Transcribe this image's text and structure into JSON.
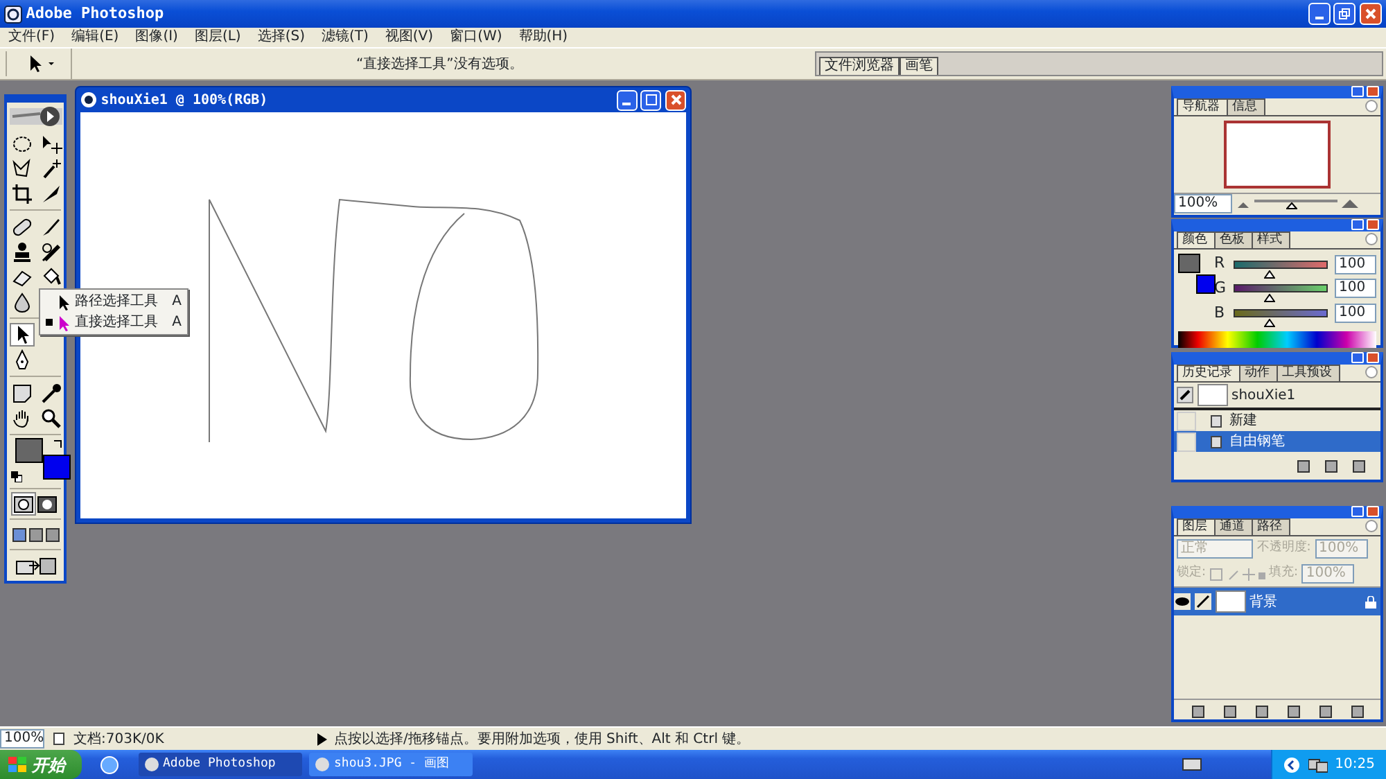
{
  "window": {
    "title": "Adobe Photoshop"
  },
  "menu": [
    "文件(F)",
    "编辑(E)",
    "图像(I)",
    "图层(L)",
    "选择(S)",
    "滤镜(T)",
    "视图(V)",
    "窗口(W)",
    "帮助(H)"
  ],
  "options_bar": {
    "message": "“直接选择工具”没有选项。"
  },
  "palette_well": {
    "tabs": [
      "文件浏览器",
      "画笔"
    ]
  },
  "tool_flyout": [
    {
      "label": "路径选择工具",
      "shortcut": "A",
      "selected": false
    },
    {
      "label": "直接选择工具",
      "shortcut": "A",
      "selected": true
    }
  ],
  "document": {
    "title": "shouXie1 @ 100%(RGB)"
  },
  "navigator": {
    "tabs": [
      {
        "label": "导航器",
        "selected": true
      },
      {
        "label": "信息",
        "selected": false
      }
    ],
    "zoom": "100%",
    "zoom_slider": {
      "level": 0.45
    }
  },
  "color_panel": {
    "tabs": [
      {
        "label": "颜色",
        "selected": true
      },
      {
        "label": "色板",
        "selected": false
      },
      {
        "label": "样式",
        "selected": false
      }
    ],
    "channels": [
      {
        "name": "R",
        "value": "100",
        "level": 0.39
      },
      {
        "name": "G",
        "value": "100",
        "level": 0.39
      },
      {
        "name": "B",
        "value": "100",
        "level": 0.39
      }
    ]
  },
  "history": {
    "tabs": [
      {
        "label": "历史记录",
        "selected": true
      },
      {
        "label": "动作",
        "selected": false
      },
      {
        "label": "工具预设",
        "selected": false
      }
    ],
    "snapshot": "shouXie1",
    "states": [
      {
        "label": "新建",
        "selected": false
      },
      {
        "label": "自由钢笔",
        "selected": true
      }
    ]
  },
  "layers": {
    "tabs": [
      {
        "label": "图层",
        "selected": true
      },
      {
        "label": "通道",
        "selected": false
      },
      {
        "label": "路径",
        "selected": false
      }
    ],
    "blend_mode": "正常",
    "opacity_label": "不透明度:",
    "opacity": "100%",
    "lock_label": "锁定:",
    "fill_label": "填充:",
    "fill": "100%",
    "items": [
      {
        "name": "背景",
        "selected": true
      }
    ]
  },
  "status_bar": {
    "zoom": "100%",
    "document_size": "文档:703K/0K",
    "hint": "点按以选择/拖移锚点。要用附加选项，使用 Shift、Alt 和 Ctrl 键。"
  },
  "taskbar": {
    "start": "开始",
    "tasks": [
      {
        "label": "Adobe Photoshop",
        "selected": true
      },
      {
        "label": "shou3.JPG - 画图",
        "selected": false
      }
    ],
    "clock": "10:25"
  }
}
